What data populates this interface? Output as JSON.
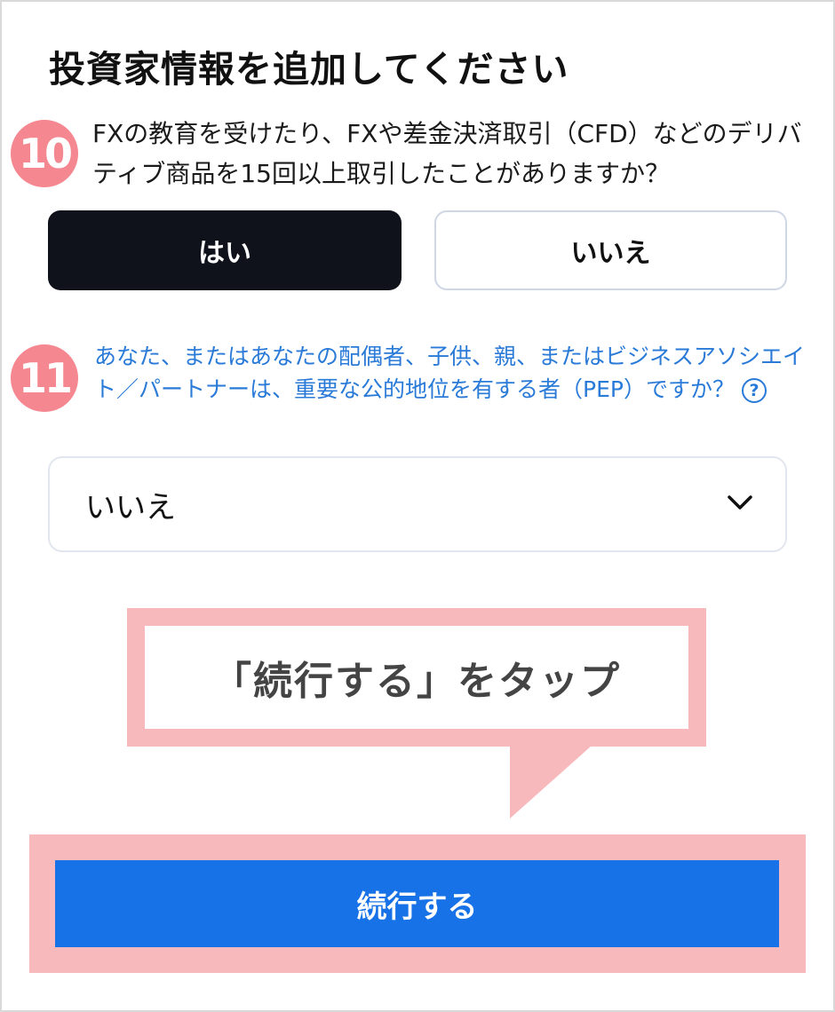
{
  "page": {
    "title": "投資家情報を追加してください"
  },
  "question10": {
    "badge": "10",
    "text": "FXの教育を受けたり、FXや差金決済取引（CFD）などのデリバティブ商品を15回以上取引したことがありますか？",
    "options": {
      "yes": "はい",
      "no": "いいえ"
    },
    "selected": "はい"
  },
  "question11": {
    "badge": "11",
    "text": "あなた、またはあなたの配偶者、子供、親、またはビジネスアソシエイト／パートナーは、重要な公的地位を有する者（PEP）ですか？",
    "help_icon_label": "?",
    "select_value": "いいえ"
  },
  "callout": {
    "text": "「続行する」をタップ"
  },
  "continue_button": {
    "label": "続行する"
  },
  "colors": {
    "primary": "#1672e6",
    "badge": "#f4878f",
    "highlight": "#f8b9bc",
    "link": "#2a7ad8",
    "selected_button": "#0f121b"
  }
}
